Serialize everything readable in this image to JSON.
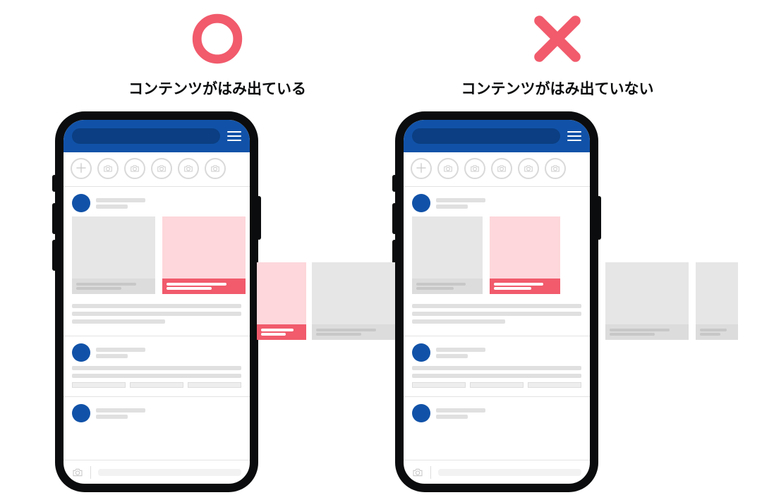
{
  "good": {
    "symbol": "circle",
    "caption": "コンテンツがはみ出ている"
  },
  "bad": {
    "symbol": "cross",
    "caption": "コンテンツがはみ出ていない"
  },
  "colors": {
    "accent": "#f15b6c",
    "brand": "#1152a8"
  },
  "icons": {
    "add_story": "＋",
    "camera": "camera-icon",
    "menu": "burger-icon"
  }
}
